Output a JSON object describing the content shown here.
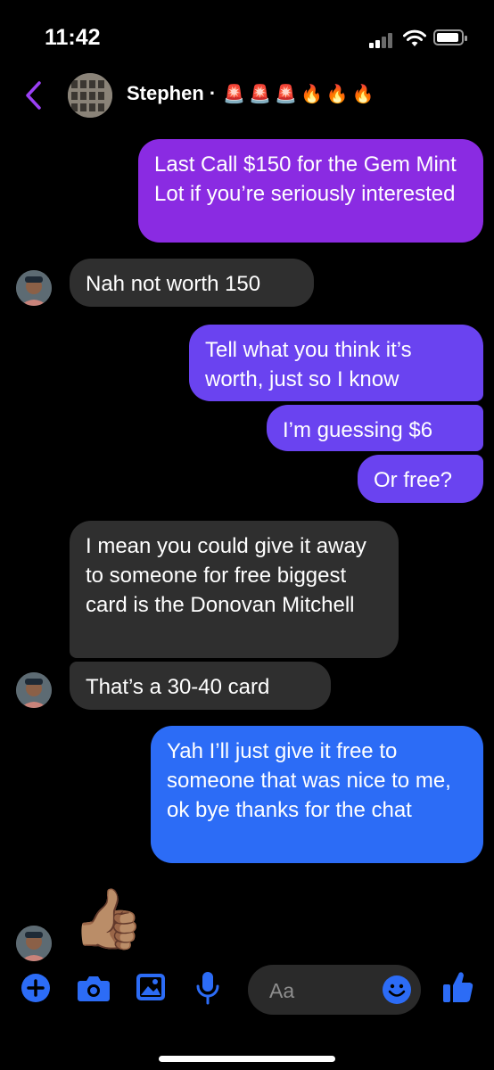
{
  "status_bar": {
    "time": "11:42"
  },
  "header": {
    "contact_name": "Stephen ·",
    "title_emojis": "🚨🚨🚨🔥🔥🔥"
  },
  "messages": [
    {
      "from": "me",
      "text": "Last Call $150 for the Gem Mint Lot if you’re seriously interested"
    },
    {
      "from": "them",
      "text": "Nah not worth 150"
    },
    {
      "from": "me",
      "text": "Tell what you think it’s worth, just so I know"
    },
    {
      "from": "me",
      "text": "I’m guessing $6"
    },
    {
      "from": "me",
      "text": "Or free?"
    },
    {
      "from": "them",
      "text": "I mean you could give it away to someone for free biggest card is the Donovan Mitchell"
    },
    {
      "from": "them",
      "text": "That’s a 30-40 card"
    },
    {
      "from": "me",
      "text": "Yah I’ll just give it free to someone that was nice to me, ok bye thanks for the chat"
    },
    {
      "from": "them",
      "text": "👍🏽"
    }
  ],
  "composer": {
    "placeholder": "Aa"
  },
  "colors": {
    "accent": "#2c6cf6",
    "bubble_purple": "#8a2be2",
    "bubble_violet": "#6a43f0",
    "bubble_blue": "#2c6cf6",
    "bubble_incoming": "#2f2f2f",
    "back_chevron": "#9b40f5"
  },
  "icons": [
    "back-chevron-icon",
    "plus-icon",
    "camera-icon",
    "gallery-icon",
    "microphone-icon",
    "emoji-icon",
    "thumbs-up-icon"
  ]
}
